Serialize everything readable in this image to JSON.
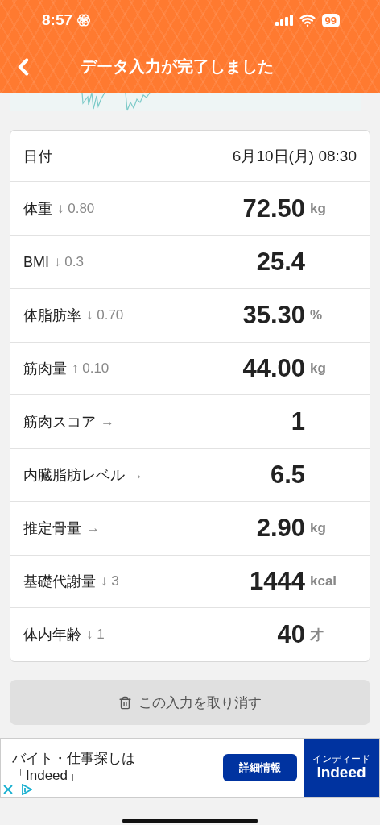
{
  "status_bar": {
    "time": "8:57",
    "battery": "99"
  },
  "header": {
    "title": "データ入力が完了しました"
  },
  "date_row": {
    "label": "日付",
    "value": "6月10日(月) 08:30"
  },
  "measurements": [
    {
      "label": "体重",
      "trend": "↓ 0.80",
      "value": "72.50",
      "unit": "kg"
    },
    {
      "label": "BMI",
      "trend": "↓ 0.3",
      "value": "25.4"
    },
    {
      "label": "体脂肪率",
      "trend": "↓ 0.70",
      "value": "35.30",
      "unit": "%"
    },
    {
      "label": "筋肉量",
      "trend": "↑ 0.10",
      "value": "44.00",
      "unit": "kg"
    },
    {
      "label": "筋肉スコア",
      "trend": "→",
      "value": "1"
    },
    {
      "label": "内臓脂肪レベル",
      "trend": "→",
      "value": "6.5"
    },
    {
      "label": "推定骨量",
      "trend": "→",
      "value": "2.90",
      "unit": "kg"
    },
    {
      "label": "基礎代謝量",
      "trend": "↓ 3",
      "value": "1444",
      "unit": "kcal"
    },
    {
      "label": "体内年齢",
      "trend": "↓ 1",
      "value": "40",
      "unit": "才"
    }
  ],
  "cancel_button": {
    "label": "この入力を取り消す"
  },
  "ad": {
    "text_lines": [
      "バイト・仕事探しは",
      "「Indeed」"
    ],
    "button": "詳細情報",
    "logo": "indeed",
    "logo_reading": "インディード"
  }
}
